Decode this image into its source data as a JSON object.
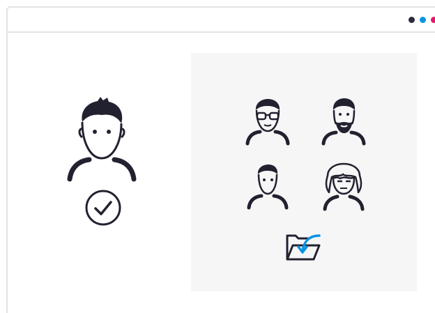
{
  "window": {
    "dots": [
      {
        "name": "dark-dot",
        "color": "#2b2a3d"
      },
      {
        "name": "blue-dot",
        "color": "#0a94e3"
      },
      {
        "name": "pink-dot",
        "color": "#e5176c"
      }
    ]
  },
  "colors": {
    "ink": "#22212f",
    "panel": "#f6f6f7",
    "accent": "#0a94e3"
  },
  "main_user": {
    "icon": "user-avatar-icon",
    "status_icon": "check-circle-icon"
  },
  "user_grid": {
    "avatars": [
      {
        "icon": "glasses-user-icon"
      },
      {
        "icon": "bearded-user-icon"
      },
      {
        "icon": "short-hair-user-icon"
      },
      {
        "icon": "long-hair-user-icon"
      }
    ],
    "action_icon": "folder-import-icon"
  }
}
